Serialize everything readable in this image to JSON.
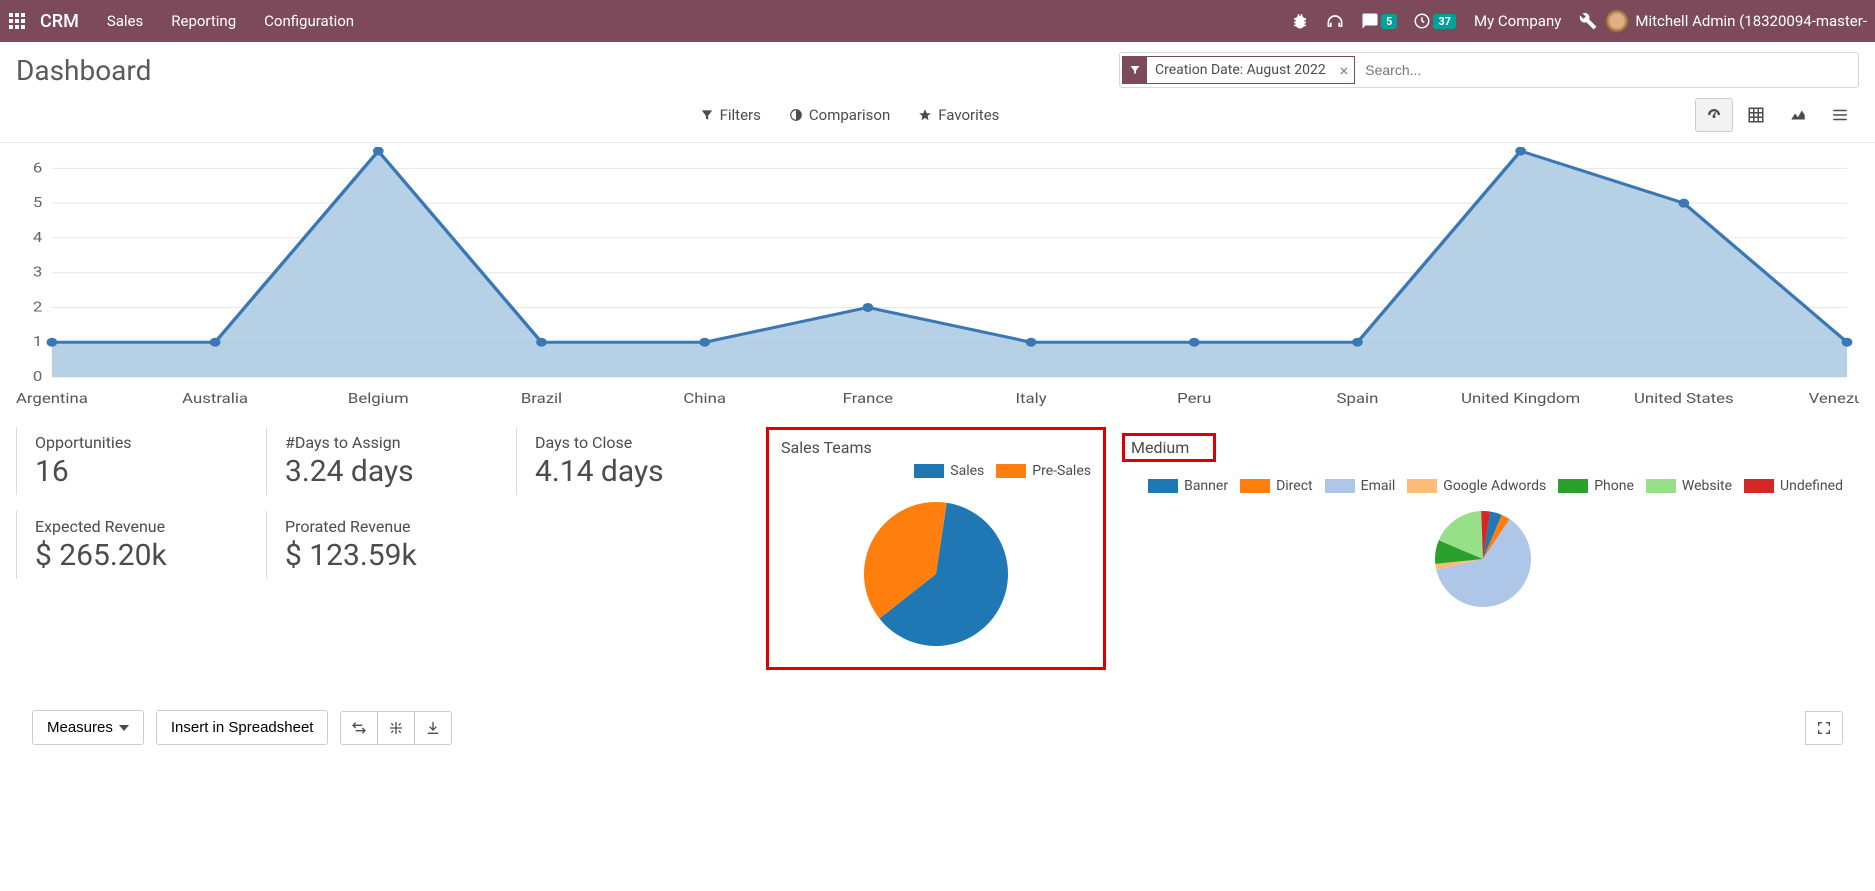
{
  "topnav": {
    "brand": "CRM",
    "links": [
      "Sales",
      "Reporting",
      "Configuration"
    ],
    "chat_badge": "5",
    "activity_badge": "37",
    "company": "My Company",
    "username": "Mitchell Admin (18320094-master-"
  },
  "page_title": "Dashboard",
  "search": {
    "facet_label": "Creation Date: August 2022",
    "placeholder": "Search..."
  },
  "filterbar": {
    "filters": "Filters",
    "comparison": "Comparison",
    "favorites": "Favorites"
  },
  "kpis": {
    "opportunities": {
      "label": "Opportunities",
      "value": "16"
    },
    "days_to_assign": {
      "label": "#Days to Assign",
      "value": "3.24 days"
    },
    "days_to_close": {
      "label": "Days to Close",
      "value": "4.14 days"
    },
    "expected_revenue": {
      "label": "Expected Revenue",
      "value": "$ 265.20k"
    },
    "prorated_revenue": {
      "label": "Prorated Revenue",
      "value": "$ 123.59k"
    }
  },
  "sales_teams": {
    "title": "Sales Teams",
    "legend": [
      {
        "name": "Sales",
        "color": "#1f77b4"
      },
      {
        "name": "Pre-Sales",
        "color": "#ff7f0e"
      }
    ]
  },
  "medium": {
    "title": "Medium",
    "legend": [
      {
        "name": "Banner",
        "color": "#1f77b4"
      },
      {
        "name": "Direct",
        "color": "#ff7f0e"
      },
      {
        "name": "Email",
        "color": "#aec7e8"
      },
      {
        "name": "Google Adwords",
        "color": "#ffbb78"
      },
      {
        "name": "Phone",
        "color": "#2ca02c"
      },
      {
        "name": "Website",
        "color": "#98df8a"
      },
      {
        "name": "Undefined",
        "color": "#d62728"
      }
    ]
  },
  "bottom": {
    "measures": "Measures",
    "insert_spreadsheet": "Insert in Spreadsheet"
  },
  "chart_data": [
    {
      "type": "area",
      "categories": [
        "Argentina",
        "Australia",
        "Belgium",
        "Brazil",
        "China",
        "France",
        "Italy",
        "Peru",
        "Spain",
        "United Kingdom",
        "United States",
        "Venezuela"
      ],
      "values": [
        1,
        1,
        7,
        1,
        1,
        2,
        1,
        1,
        1,
        7,
        5,
        1
      ],
      "ylim": [
        0,
        6
      ],
      "yticks": [
        0,
        1,
        2,
        3,
        4,
        5,
        6
      ],
      "title": "",
      "xlabel": "",
      "ylabel": ""
    },
    {
      "type": "pie",
      "title": "Sales Teams",
      "series": [
        {
          "name": "Sales",
          "value": 62,
          "color": "#1f77b4"
        },
        {
          "name": "Pre-Sales",
          "value": 38,
          "color": "#ff7f0e"
        }
      ]
    },
    {
      "type": "pie",
      "title": "Medium",
      "series": [
        {
          "name": "Banner",
          "value": 4,
          "color": "#1f77b4"
        },
        {
          "name": "Direct",
          "value": 3,
          "color": "#ff7f0e"
        },
        {
          "name": "Email",
          "value": 62,
          "color": "#aec7e8"
        },
        {
          "name": "Google Adwords",
          "value": 2,
          "color": "#ffbb78"
        },
        {
          "name": "Phone",
          "value": 8,
          "color": "#2ca02c"
        },
        {
          "name": "Website",
          "value": 18,
          "color": "#98df8a"
        },
        {
          "name": "Undefined",
          "value": 3,
          "color": "#d62728"
        }
      ]
    }
  ]
}
